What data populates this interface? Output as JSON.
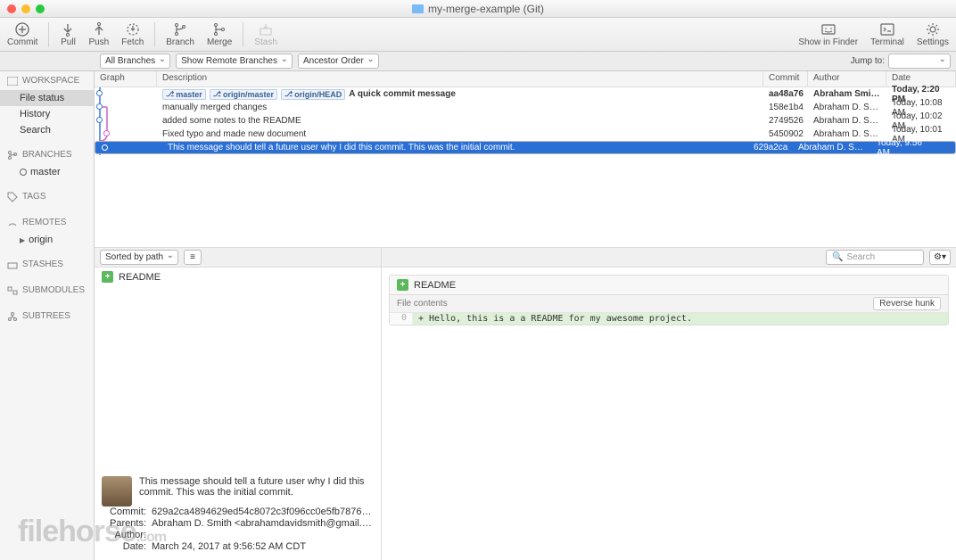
{
  "window": {
    "title": "my-merge-example (Git)"
  },
  "toolbar": {
    "commit": "Commit",
    "pull": "Pull",
    "push": "Push",
    "fetch": "Fetch",
    "branch": "Branch",
    "merge": "Merge",
    "stash": "Stash",
    "show_in_finder": "Show in Finder",
    "terminal": "Terminal",
    "settings": "Settings"
  },
  "filters": {
    "branches": "All Branches",
    "remote": "Show Remote Branches",
    "order": "Ancestor Order",
    "jumpto_label": "Jump to:"
  },
  "sidebar": {
    "workspace": {
      "label": "WORKSPACE",
      "items": [
        "File status",
        "History",
        "Search"
      ]
    },
    "branches": {
      "label": "BRANCHES",
      "items": [
        "master"
      ]
    },
    "tags": {
      "label": "TAGS"
    },
    "remotes": {
      "label": "REMOTES",
      "items": [
        "origin"
      ]
    },
    "stashes": {
      "label": "STASHES"
    },
    "submodules": {
      "label": "SUBMODULES"
    },
    "subtrees": {
      "label": "SUBTREES"
    }
  },
  "commit_columns": {
    "graph": "Graph",
    "description": "Description",
    "commit": "Commit",
    "author": "Author",
    "date": "Date"
  },
  "commits": [
    {
      "tags": [
        "master",
        "origin/master",
        "origin/HEAD"
      ],
      "desc": "A quick commit message",
      "hash": "aa48a76",
      "author": "Abraham Smith <…",
      "date": "Today, 2:20 PM",
      "bold": true
    },
    {
      "tags": [],
      "desc": "manually merged changes",
      "hash": "158e1b4",
      "author": "Abraham D. Smith…",
      "date": "Today, 10:08 AM"
    },
    {
      "tags": [],
      "desc": "added some notes to the README",
      "hash": "2749526",
      "author": "Abraham D. Smith…",
      "date": "Today, 10:02 AM"
    },
    {
      "tags": [],
      "desc": "Fixed typo and made new document",
      "hash": "5450902",
      "author": "Abraham D. Smith…",
      "date": "Today, 10:01 AM"
    },
    {
      "tags": [],
      "desc": "This message should tell a future user why I did this commit. This was the initial commit.",
      "hash": "629a2ca",
      "author": "Abraham D. Smith…",
      "date": "Today, 9:56 AM",
      "selected": true
    }
  ],
  "sort": {
    "label": "Sorted by path"
  },
  "files": [
    {
      "name": "README",
      "status": "added"
    }
  ],
  "detail": {
    "message": "This message should tell a future user why I did this commit. This was the initial commit.",
    "commit_label": "Commit:",
    "commit": "629a2ca4894629ed54c8072c3f096cc0e5fb7876…",
    "parents_label": "Parents:",
    "parents": "Abraham D. Smith <abrahamdavidsmith@gmail.…",
    "author_label": "Author:",
    "author": "",
    "date_label": "Date:",
    "date": "March 24, 2017 at 9:56:52 AM CDT"
  },
  "diff": {
    "search_placeholder": "Search",
    "file": "README",
    "hunk_label": "File contents",
    "reverse_label": "Reverse hunk",
    "lines": [
      {
        "num": "0",
        "text": "+ Hello, this is a a README for my awesome project.",
        "type": "add"
      }
    ]
  },
  "watermark": "filehorse",
  "watermark_suffix": ".com"
}
